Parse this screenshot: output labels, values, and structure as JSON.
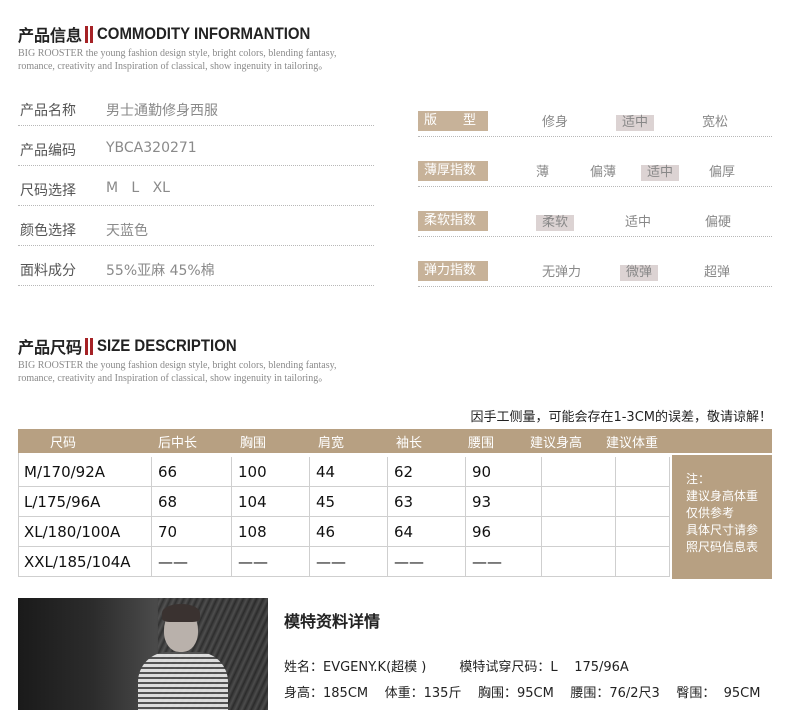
{
  "commodity_header": {
    "title_cn": "产品信息",
    "title_en": "COMMODITY INFORMANTION",
    "subtitle_line1": "BIG ROOSTER the young fashion design style, bright colors, blending fantasy,",
    "subtitle_line2": "romance, creativity and Inspiration of classical, show ingenuity in tailoring。"
  },
  "info": [
    {
      "key": "产品名称",
      "value": "男士通勤修身西服"
    },
    {
      "key": "产品编码",
      "value": "YBCA320271"
    },
    {
      "key": "尺码选择",
      "value": "M   L   XL"
    },
    {
      "key": "颜色选择",
      "value": "天蓝色"
    },
    {
      "key": "面料成分",
      "value": "55%亚麻 45%棉"
    }
  ],
  "attributes": [
    {
      "label": "版　　型",
      "options": [
        "修身",
        "适中",
        "宽松"
      ],
      "selected": 1
    },
    {
      "label": "薄厚指数",
      "options": [
        "薄",
        "偏薄",
        "适中",
        "偏厚"
      ],
      "selected": 2
    },
    {
      "label": "柔软指数",
      "options": [
        "柔软",
        "适中",
        "偏硬"
      ],
      "selected": 0
    },
    {
      "label": "弹力指数",
      "options": [
        "无弹力",
        "微弹",
        "超弹"
      ],
      "selected": 1
    }
  ],
  "size_header": {
    "title_cn": "产品尺码",
    "title_en": "SIZE DESCRIPTION",
    "subtitle_line1": "BIG ROOSTER the young fashion design style, bright colors, blending fantasy,",
    "subtitle_line2": "romance, creativity and Inspiration of classical, show ingenuity in tailoring。"
  },
  "size_notice": "因手工侧量，可能会存在1-3CM的误差，敬请谅解！",
  "size_table": {
    "headers": [
      "尺码",
      "后中长",
      "胸围",
      "肩宽",
      "袖长",
      "腰围",
      "建议身高",
      "建议体重"
    ],
    "rows": [
      [
        "M/170/92A",
        "66",
        "100",
        "44",
        "62",
        "90",
        "",
        ""
      ],
      [
        "L/175/96A",
        "68",
        "104",
        "45",
        "63",
        "93",
        "",
        ""
      ],
      [
        "XL/180/100A",
        "70",
        "108",
        "46",
        "64",
        "96",
        "",
        ""
      ],
      [
        "XXL/185/104A",
        "——",
        "——",
        "——",
        "——",
        "——",
        "",
        ""
      ]
    ],
    "note_lines": [
      "注：",
      "建议身高体重",
      "仅供参考",
      "具体尺寸请参",
      "照尺码信息表"
    ]
  },
  "model": {
    "title": "模特资料详情",
    "line1": "姓名：EVGENY.K(超模 )        模特试穿尺码：L    175/96A",
    "line2": "身高：185CM    体重：135斤    胸围：95CM    腰围：76/2尺3    臀围：  95CM"
  },
  "colors": {
    "accent_red": "#a52226",
    "label_tan": "#c7b299",
    "table_tan": "#b7a082",
    "selected_bg": "#dcd3d3"
  }
}
